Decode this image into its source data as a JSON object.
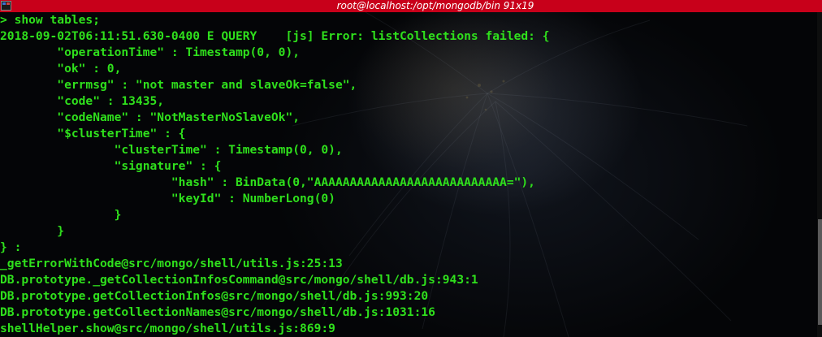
{
  "window": {
    "title": "root@localhost:/opt/mongodb/bin 91x19"
  },
  "terminal": {
    "text_color": "#2fe01c",
    "lines": [
      "> show tables;",
      "2018-09-02T06:11:51.630-0400 E QUERY    [js] Error: listCollections failed: {",
      "        \"operationTime\" : Timestamp(0, 0),",
      "        \"ok\" : 0,",
      "        \"errmsg\" : \"not master and slaveOk=false\",",
      "        \"code\" : 13435,",
      "        \"codeName\" : \"NotMasterNoSlaveOk\",",
      "        \"$clusterTime\" : {",
      "                \"clusterTime\" : Timestamp(0, 0),",
      "                \"signature\" : {",
      "                        \"hash\" : BinData(0,\"AAAAAAAAAAAAAAAAAAAAAAAAAAA=\"),",
      "                        \"keyId\" : NumberLong(0)",
      "                }",
      "        }",
      "} :",
      "_getErrorWithCode@src/mongo/shell/utils.js:25:13",
      "DB.prototype._getCollectionInfosCommand@src/mongo/shell/db.js:943:1",
      "DB.prototype.getCollectionInfos@src/mongo/shell/db.js:993:20",
      "DB.prototype.getCollectionNames@src/mongo/shell/db.js:1031:16",
      "shellHelper.show@src/mongo/shell/utils.js:869:9"
    ]
  }
}
